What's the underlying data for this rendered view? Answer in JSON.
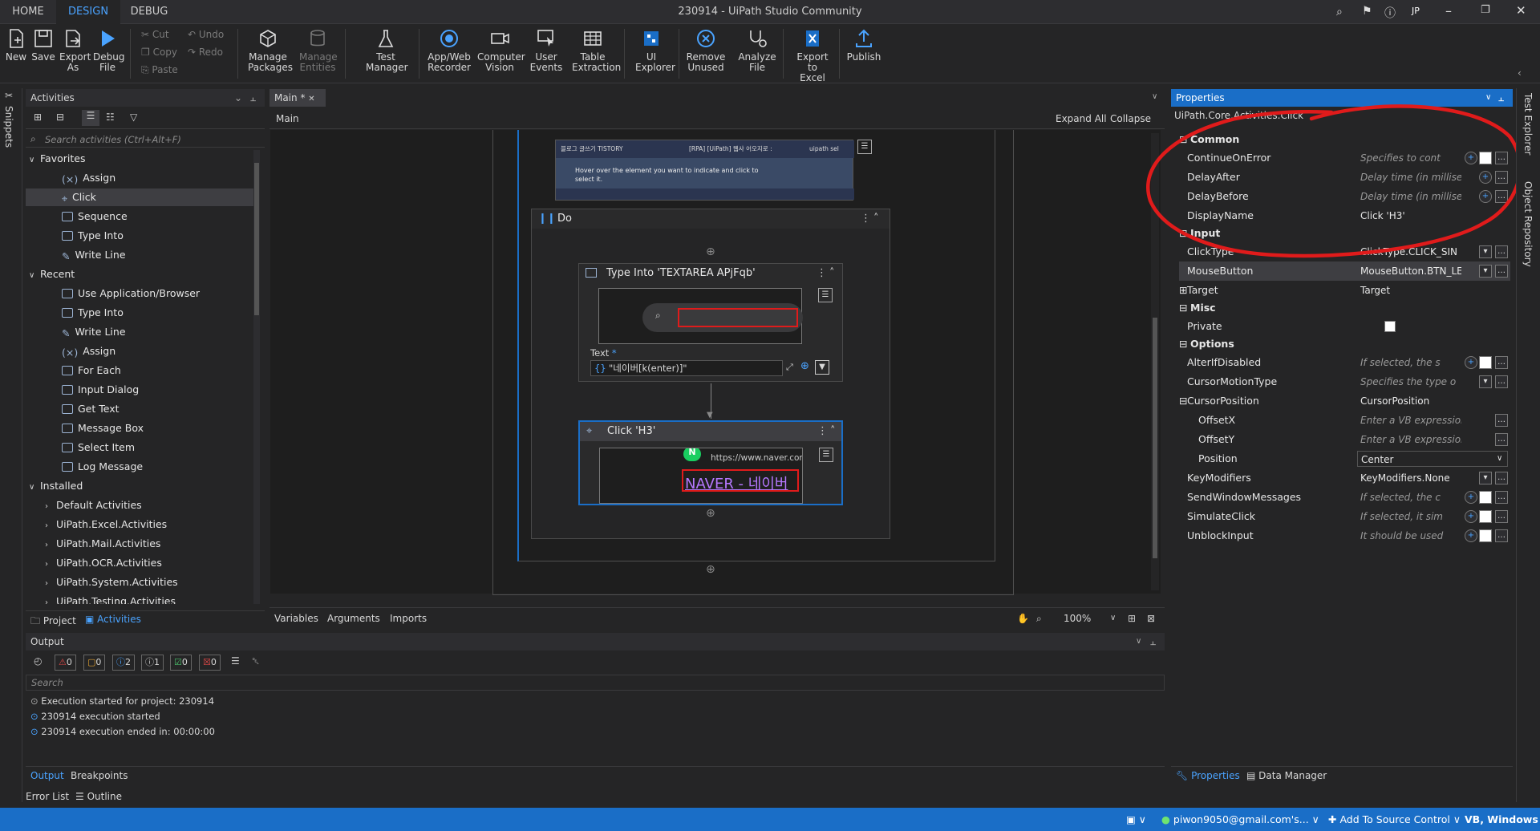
{
  "window": {
    "title": "230914 - UiPath Studio Community",
    "user_initials": "JP"
  },
  "tabs": [
    {
      "label": "HOME"
    },
    {
      "label": "DESIGN"
    },
    {
      "label": "DEBUG"
    }
  ],
  "ribbon": {
    "new": "New",
    "save": "Save",
    "export_as": "Export As",
    "debug_file": "Debug File",
    "cut": "Cut",
    "copy": "Copy",
    "paste": "Paste",
    "undo": "Undo",
    "redo": "Redo",
    "manage_packages": "Manage Packages",
    "manage_entities": "Manage Entities",
    "test_manager": "Test Manager",
    "app_web_recorder": "App/Web Recorder",
    "computer_vision": "Computer Vision",
    "user_events": "User Events",
    "table_extraction": "Table Extraction",
    "ui_explorer": "UI Explorer",
    "remove_unused": "Remove Unused",
    "analyze_file": "Analyze File",
    "export_to_excel": "Export to Excel",
    "publish": "Publish"
  },
  "activities_panel": {
    "title": "Activities",
    "search_placeholder": "Search activities (Ctrl+Alt+F)",
    "favorites_label": "Favorites",
    "favorites": [
      "Assign",
      "Click",
      "Sequence",
      "Type Into",
      "Write Line"
    ],
    "recent_label": "Recent",
    "recent": [
      "Use Application/Browser",
      "Type Into",
      "Write Line",
      "Assign",
      "For Each",
      "Input Dialog",
      "Get Text",
      "Message Box",
      "Select Item",
      "Log Message"
    ],
    "installed_label": "Installed",
    "installed": [
      "Default Activities",
      "UiPath.Excel.Activities",
      "UiPath.Mail.Activities",
      "UiPath.OCR.Activities",
      "UiPath.System.Activities",
      "UiPath.Testing.Activities"
    ],
    "bottom_tabs": [
      "Project",
      "Activities"
    ]
  },
  "left_strip": {
    "snippets": "Snippets"
  },
  "designer": {
    "doc_tab": "Main *",
    "breadcrumb": "Main",
    "expand_all": "Expand All",
    "collapse_all": "Collapse All",
    "do_label": "Do",
    "type_into_title": "Type Into 'TEXTAREA  APjFqb'",
    "text_label": "Text",
    "text_value": "\"네이버[k(enter)]\"",
    "click_title": "Click 'H3'",
    "click_preview_url": "https://www.naver.com",
    "click_preview_text": "NAVER - 네이버",
    "browser_thumb_tabs": [
      "블로그 글쓰기 TISTORY",
      "[RPA] [UiPath] 웹사 어오지로 :",
      "uipath sel"
    ],
    "browser_thumb_hint": "Hover over the element you want to indicate and click to select it.",
    "bottom_tabs": [
      "Variables",
      "Arguments",
      "Imports"
    ],
    "zoom": "100%"
  },
  "output_panel": {
    "title": "Output",
    "counts": {
      "errors": "0",
      "warnings": "0",
      "info": "2",
      "trace": "1",
      "success": "0",
      "fail": "0"
    },
    "search_placeholder": "Search",
    "lines": [
      "Execution started for project: 230914",
      "230914 execution started",
      "230914 execution ended in: 00:00:00"
    ],
    "bottom_tabs": [
      "Output",
      "Breakpoints"
    ],
    "error_list": "Error List",
    "outline": "Outline"
  },
  "properties_panel": {
    "title": "Properties",
    "activity_type": "UiPath.Core.Activities.Click",
    "categories": {
      "common": "Common",
      "input": "Input",
      "misc": "Misc",
      "options": "Options"
    },
    "common": [
      {
        "name": "ContinueOnError",
        "value": "Specifies to cont"
      },
      {
        "name": "DelayAfter",
        "value": "Delay time (in millise"
      },
      {
        "name": "DelayBefore",
        "value": "Delay time (in millise"
      },
      {
        "name": "DisplayName",
        "value": "Click 'H3'"
      }
    ],
    "input": [
      {
        "name": "ClickType",
        "value": "ClickType.CLICK_SIN"
      },
      {
        "name": "MouseButton",
        "value": "MouseButton.BTN_LE"
      },
      {
        "name": "Target",
        "value": "Target"
      }
    ],
    "misc": [
      {
        "name": "Private",
        "value": ""
      }
    ],
    "options": [
      {
        "name": "AlterIfDisabled",
        "value": "If selected, the s"
      },
      {
        "name": "CursorMotionType",
        "value": "Specifies the type o"
      },
      {
        "name": "CursorPosition",
        "value": "CursorPosition"
      },
      {
        "name": "OffsetX",
        "value": "Enter a VB expression"
      },
      {
        "name": "OffsetY",
        "value": "Enter a VB expression"
      },
      {
        "name": "Position",
        "value": "Center"
      },
      {
        "name": "KeyModifiers",
        "value": "KeyModifiers.None"
      },
      {
        "name": "SendWindowMessages",
        "value": "If selected, the c"
      },
      {
        "name": "SimulateClick",
        "value": "If selected, it sim"
      },
      {
        "name": "UnblockInput",
        "value": "It should be used"
      }
    ],
    "bottom_tabs": [
      "Properties",
      "Data Manager"
    ]
  },
  "right_strip": {
    "test_explorer": "Test Explorer",
    "object_repository": "Object Repository"
  },
  "statusbar": {
    "account": "piwon9050@gmail.com's...",
    "source_control": "Add To Source Control",
    "language": "VB, Windows"
  },
  "colors": {
    "accent": "#1a6ec7",
    "annotation": "#e01b1b",
    "selection": "#3e3e42"
  }
}
